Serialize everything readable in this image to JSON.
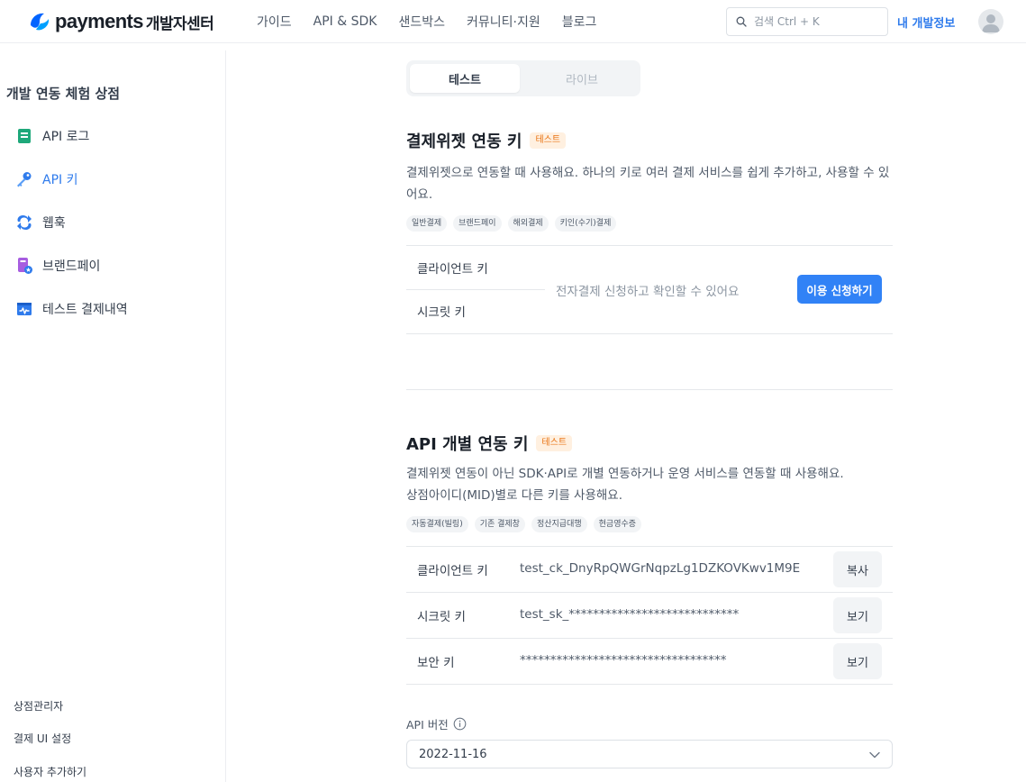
{
  "header": {
    "logo_word": "payments",
    "logo_sub": "개발자센터",
    "nav": [
      "가이드",
      "API & SDK",
      "샌드박스",
      "커뮤니티·지원",
      "블로그"
    ],
    "search_placeholder": "검색 Ctrl + K",
    "my_info": "내 개발정보"
  },
  "sidebar": {
    "title": "개발 연동 체험 상점",
    "items": [
      {
        "label": "API 로그",
        "icon": "document-icon"
      },
      {
        "label": "API 키",
        "icon": "key-icon",
        "active": true
      },
      {
        "label": "웹훅",
        "icon": "refresh-icon"
      },
      {
        "label": "브랜드페이",
        "icon": "brandpay-icon"
      },
      {
        "label": "테스트 결제내역",
        "icon": "receipt-icon"
      }
    ],
    "bottom": [
      "상점관리자",
      "결제 UI 설정",
      "사용자 추가하기"
    ]
  },
  "mode": {
    "test": "테스트",
    "live": "라이브",
    "selected": "테스트"
  },
  "widget": {
    "title": "결제위젯 연동 키",
    "badge": "테스트",
    "desc": "결제위젯으로 연동할 때 사용해요. 하나의 키로 여러 결제 서비스를 쉽게 추가하고, 사용할 수 있어요.",
    "chips": [
      "일반결제",
      "브랜드페이",
      "해외결제",
      "키인(수기)결제"
    ],
    "client_key_label": "클라이언트 키",
    "secret_key_label": "시크릿 키",
    "notice": "전자결제 신청하고 확인할 수 있어요",
    "apply_button": "이용 신청하기"
  },
  "api": {
    "title": "API 개별 연동 키",
    "badge": "테스트",
    "desc1": "결제위젯 연동이 아닌 SDK·API로 개별 연동하거나 운영 서비스를 연동할 때 사용해요.",
    "desc2": "상점아이디(MID)별로 다른 키를 사용해요.",
    "chips": [
      "자동결제(빌링)",
      "기존 결제창",
      "정산지급대행",
      "현금영수증"
    ],
    "rows": [
      {
        "label": "클라이언트 키",
        "value": "test_ck_DnyRpQWGrNqpzLg1DZKOVKwv1M9E",
        "button": "복사"
      },
      {
        "label": "시크릿 키",
        "value": "test_sk_****************************",
        "button": "보기"
      },
      {
        "label": "보안 키",
        "value": "**********************************",
        "button": "보기"
      }
    ],
    "version_label": "API 버전",
    "version_value": "2022-11-16"
  },
  "colors": {
    "accent": "#3182f6",
    "badge_bg": "#fff0e0",
    "badge_text": "#e97313"
  }
}
